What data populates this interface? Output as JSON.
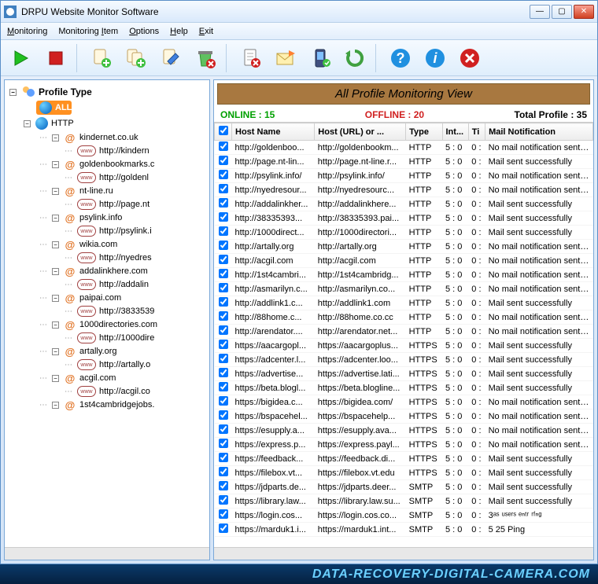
{
  "title": "DRPU Website Monitor Software",
  "menu": [
    "Monitoring",
    "Monitoring Item",
    "Options",
    "Help",
    "Exit"
  ],
  "toolbar": [
    {
      "name": "play",
      "color": "#20c020"
    },
    {
      "name": "stop",
      "color": "#d02020"
    },
    {
      "sep": true
    },
    {
      "name": "add-profile"
    },
    {
      "name": "add-group"
    },
    {
      "name": "edit-profile"
    },
    {
      "name": "delete-profile"
    },
    {
      "sep": true
    },
    {
      "name": "remove-doc"
    },
    {
      "name": "mail"
    },
    {
      "name": "phone"
    },
    {
      "name": "refresh"
    },
    {
      "sep": true
    },
    {
      "name": "help",
      "color": "#1080e0"
    },
    {
      "name": "info",
      "color": "#1080e0"
    },
    {
      "name": "close-x",
      "color": "#d02020"
    }
  ],
  "sidebar": {
    "root": "Profile Type",
    "all": "ALL",
    "http": "HTTP",
    "nodes": [
      {
        "host": "kindernet.co.uk",
        "url": "http://kindern"
      },
      {
        "host": "goldenbookmarks.c",
        "url": "http://goldenl"
      },
      {
        "host": "nt-line.ru",
        "url": "http://page.nt"
      },
      {
        "host": "psylink.info",
        "url": "http://psylink.i"
      },
      {
        "host": "wikia.com",
        "url": "http://nyedres"
      },
      {
        "host": "addalinkhere.com",
        "url": "http://addalin"
      },
      {
        "host": "paipai.com",
        "url": "http://3833539"
      },
      {
        "host": "1000directories.com",
        "url": "http://1000dire"
      },
      {
        "host": "artally.org",
        "url": "http://artally.o"
      },
      {
        "host": "acgil.com",
        "url": "http://acgil.co"
      },
      {
        "host": "1st4cambridgejobs.",
        "url": ""
      }
    ]
  },
  "view": {
    "title": "All Profile Monitoring View",
    "online_label": "ONLINE : 15",
    "offline_label": "OFFLINE : 20",
    "total_label": "Total Profile : 35",
    "columns": [
      "",
      "Host Name",
      "Host (URL) or ...",
      "Type",
      "Int...",
      "Ti",
      "Mail Notification"
    ],
    "rows": [
      {
        "h": "http://goldenboo...",
        "u": "http://goldenbookm...",
        "t": "HTTP",
        "i": "5 : 0",
        "ti": "0 :",
        "m": "No mail notification sent for"
      },
      {
        "h": "http://page.nt-lin...",
        "u": "http://page.nt-line.r...",
        "t": "HTTP",
        "i": "5 : 0",
        "ti": "0 :",
        "m": "Mail sent successfully"
      },
      {
        "h": "http://psylink.info/",
        "u": "http://psylink.info/",
        "t": "HTTP",
        "i": "5 : 0",
        "ti": "0 :",
        "m": "No mail notification sent for"
      },
      {
        "h": "http://nyedresour...",
        "u": "http://nyedresourc...",
        "t": "HTTP",
        "i": "5 : 0",
        "ti": "0 :",
        "m": "No mail notification sent for"
      },
      {
        "h": "http://addalinkher...",
        "u": "http://addalinkhere...",
        "t": "HTTP",
        "i": "5 : 0",
        "ti": "0 :",
        "m": "Mail sent successfully"
      },
      {
        "h": "http://38335393...",
        "u": "http://38335393.pai...",
        "t": "HTTP",
        "i": "5 : 0",
        "ti": "0 :",
        "m": "Mail sent successfully"
      },
      {
        "h": "http://1000direct...",
        "u": "http://1000directori...",
        "t": "HTTP",
        "i": "5 : 0",
        "ti": "0 :",
        "m": "Mail sent successfully"
      },
      {
        "h": "http://artally.org",
        "u": "http://artally.org",
        "t": "HTTP",
        "i": "5 : 0",
        "ti": "0 :",
        "m": "No mail notification sent for"
      },
      {
        "h": "http://acgil.com",
        "u": "http://acgil.com",
        "t": "HTTP",
        "i": "5 : 0",
        "ti": "0 :",
        "m": "No mail notification sent for"
      },
      {
        "h": "http://1st4cambri...",
        "u": "http://1st4cambridg...",
        "t": "HTTP",
        "i": "5 : 0",
        "ti": "0 :",
        "m": "No mail notification sent for"
      },
      {
        "h": "http://asmarilyn.c...",
        "u": "http://asmarilyn.co...",
        "t": "HTTP",
        "i": "5 : 0",
        "ti": "0 :",
        "m": "No mail notification sent for"
      },
      {
        "h": "http://addlink1.c...",
        "u": "http://addlink1.com",
        "t": "HTTP",
        "i": "5 : 0",
        "ti": "0 :",
        "m": "Mail sent successfully"
      },
      {
        "h": "http://88home.c...",
        "u": "http://88home.co.cc",
        "t": "HTTP",
        "i": "5 : 0",
        "ti": "0 :",
        "m": "No mail notification sent for"
      },
      {
        "h": "http://arendator....",
        "u": "http://arendator.net...",
        "t": "HTTP",
        "i": "5 : 0",
        "ti": "0 :",
        "m": "No mail notification sent for"
      },
      {
        "h": "https://aacargopl...",
        "u": "https://aacargoplus...",
        "t": "HTTPS",
        "i": "5 : 0",
        "ti": "0 :",
        "m": "Mail sent successfully"
      },
      {
        "h": "https://adcenter.l...",
        "u": "https://adcenter.loo...",
        "t": "HTTPS",
        "i": "5 : 0",
        "ti": "0 :",
        "m": "Mail sent successfully"
      },
      {
        "h": "https://advertise...",
        "u": "https://advertise.lati...",
        "t": "HTTPS",
        "i": "5 : 0",
        "ti": "0 :",
        "m": "Mail sent successfully"
      },
      {
        "h": "https://beta.blogl...",
        "u": "https://beta.blogline...",
        "t": "HTTPS",
        "i": "5 : 0",
        "ti": "0 :",
        "m": "Mail sent successfully"
      },
      {
        "h": "https://bigidea.c...",
        "u": "https://bigidea.com/",
        "t": "HTTPS",
        "i": "5 : 0",
        "ti": "0 :",
        "m": "No mail notification sent for"
      },
      {
        "h": "https://bspacehel...",
        "u": "https://bspacehelp...",
        "t": "HTTPS",
        "i": "5 : 0",
        "ti": "0 :",
        "m": "No mail notification sent for"
      },
      {
        "h": "https://esupply.a...",
        "u": "https://esupply.ava...",
        "t": "HTTPS",
        "i": "5 : 0",
        "ti": "0 :",
        "m": "No mail notification sent for"
      },
      {
        "h": "https://express.p...",
        "u": "https://express.payl...",
        "t": "HTTPS",
        "i": "5 : 0",
        "ti": "0 :",
        "m": "No mail notification sent for"
      },
      {
        "h": "https://feedback...",
        "u": "https://feedback.di...",
        "t": "HTTPS",
        "i": "5 : 0",
        "ti": "0 :",
        "m": "Mail sent successfully"
      },
      {
        "h": "https://filebox.vt...",
        "u": "https://filebox.vt.edu",
        "t": "HTTPS",
        "i": "5 : 0",
        "ti": "0 :",
        "m": "Mail sent successfully"
      },
      {
        "h": "https://jdparts.de...",
        "u": "https://jdparts.deer...",
        "t": "SMTP",
        "i": "5 : 0",
        "ti": "0 :",
        "m": "Mail sent successfully"
      },
      {
        "h": "https://library.law...",
        "u": "https://library.law.su...",
        "t": "SMTP",
        "i": "5 : 0",
        "ti": "0 :",
        "m": "Mail sent successfully"
      },
      {
        "h": "https://login.cos...",
        "u": "https://login.cos.co...",
        "t": "SMTP",
        "i": "5 : 0",
        "ti": "0 :",
        "m": "3ᵃˢ ᵘˢᵉʳˢ ᵉⁿᵗʳ ʳᶠⁿᵍ"
      },
      {
        "h": "https://marduk1.i...",
        "u": "https://marduk1.int...",
        "t": "SMTP",
        "i": "5 : 0",
        "ti": "0 :",
        "m": "5        25        Ping"
      }
    ]
  },
  "footer": "DATA-RECOVERY-DIGITAL-CAMERA.COM"
}
